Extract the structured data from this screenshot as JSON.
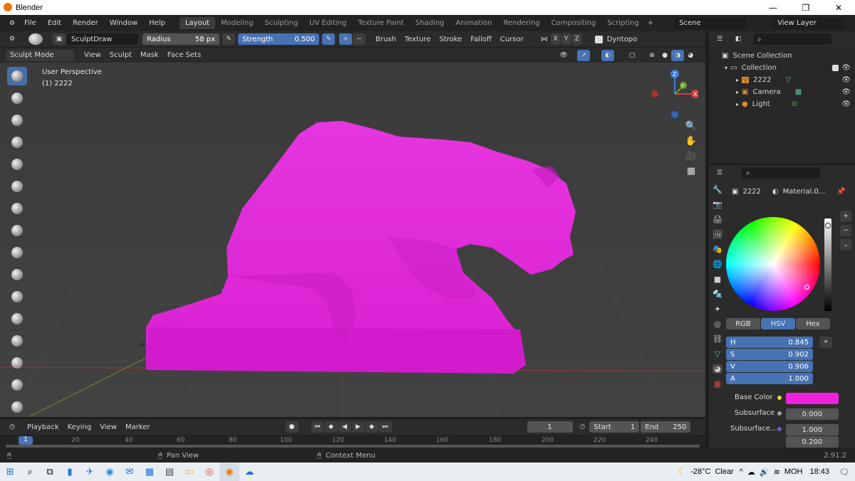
{
  "window": {
    "title": "Blender",
    "minimize": "—",
    "maximize": "❐",
    "close": "✕"
  },
  "menu": {
    "file": "File",
    "edit": "Edit",
    "render": "Render",
    "window": "Window",
    "help": "Help"
  },
  "workspaces": [
    "Layout",
    "Modeling",
    "Sculpting",
    "UV Editing",
    "Texture Paint",
    "Shading",
    "Animation",
    "Rendering",
    "Compositing",
    "Scripting"
  ],
  "scene": {
    "name": "Scene",
    "view_layer": "View Layer"
  },
  "toolbar": {
    "brush_name": "SculptDraw",
    "radius_label": "Radius",
    "radius_value": "58 px",
    "strength_label": "Strength",
    "strength_value": "0.500",
    "plus": "+",
    "minus": "−",
    "brush": "Brush",
    "texture": "Texture",
    "stroke": "Stroke",
    "falloff": "Falloff",
    "cursor": "Cursor",
    "x": "X",
    "y": "Y",
    "z": "Z",
    "dyntopo": "Dyntopo"
  },
  "modebar": {
    "mode": "Sculpt Mode",
    "view": "View",
    "sculpt": "Sculpt",
    "mask": "Mask",
    "face_sets": "Face Sets"
  },
  "viewport": {
    "perspective": "User Perspective",
    "object_info": "(1) 2222",
    "gizmo_z": "Z",
    "gizmo_x": "X",
    "gizmo_y": "Y"
  },
  "outliner": {
    "scene_collection": "Scene Collection",
    "collection": "Collection",
    "items": [
      {
        "label": "2222"
      },
      {
        "label": "Camera"
      },
      {
        "label": "Light"
      }
    ]
  },
  "properties": {
    "object": "2222",
    "material": "Material.0...",
    "tabs": {
      "rgb": "RGB",
      "hsv": "HSV",
      "hex": "Hex"
    },
    "hsv": [
      {
        "label": "H",
        "value": "0.845"
      },
      {
        "label": "S",
        "value": "0.902"
      },
      {
        "label": "V",
        "value": "0.906"
      },
      {
        "label": "A",
        "value": "1.000"
      }
    ],
    "base_color_label": "Base Color",
    "base_color": "#ee22dd",
    "subsurface_label": "Subsurface",
    "subsurface_value": "0.000",
    "subsurface2_label": "Subsurface...",
    "subsurface2_value1": "1.000",
    "subsurface2_value2": "0.200"
  },
  "timeline": {
    "playback": "Playback",
    "keying": "Keying",
    "view": "View",
    "marker": "Marker",
    "current_frame": "1",
    "start_label": "Start",
    "start_value": "1",
    "end_label": "End",
    "end_value": "250",
    "ticks": [
      "1",
      "20",
      "40",
      "60",
      "80",
      "100",
      "120",
      "140",
      "160",
      "180",
      "200",
      "220",
      "240"
    ]
  },
  "status": {
    "pan_view": "Pan View",
    "context_menu": "Context Menu",
    "version": "2.91.2"
  },
  "taskbar": {
    "temperature": "-28°C",
    "weather": "Clear",
    "language": "МОН",
    "time": "18:43"
  },
  "colors": {
    "accent": "#4772b3",
    "model": "#e02fd8",
    "viewport_bg": "#3d3d3d"
  }
}
